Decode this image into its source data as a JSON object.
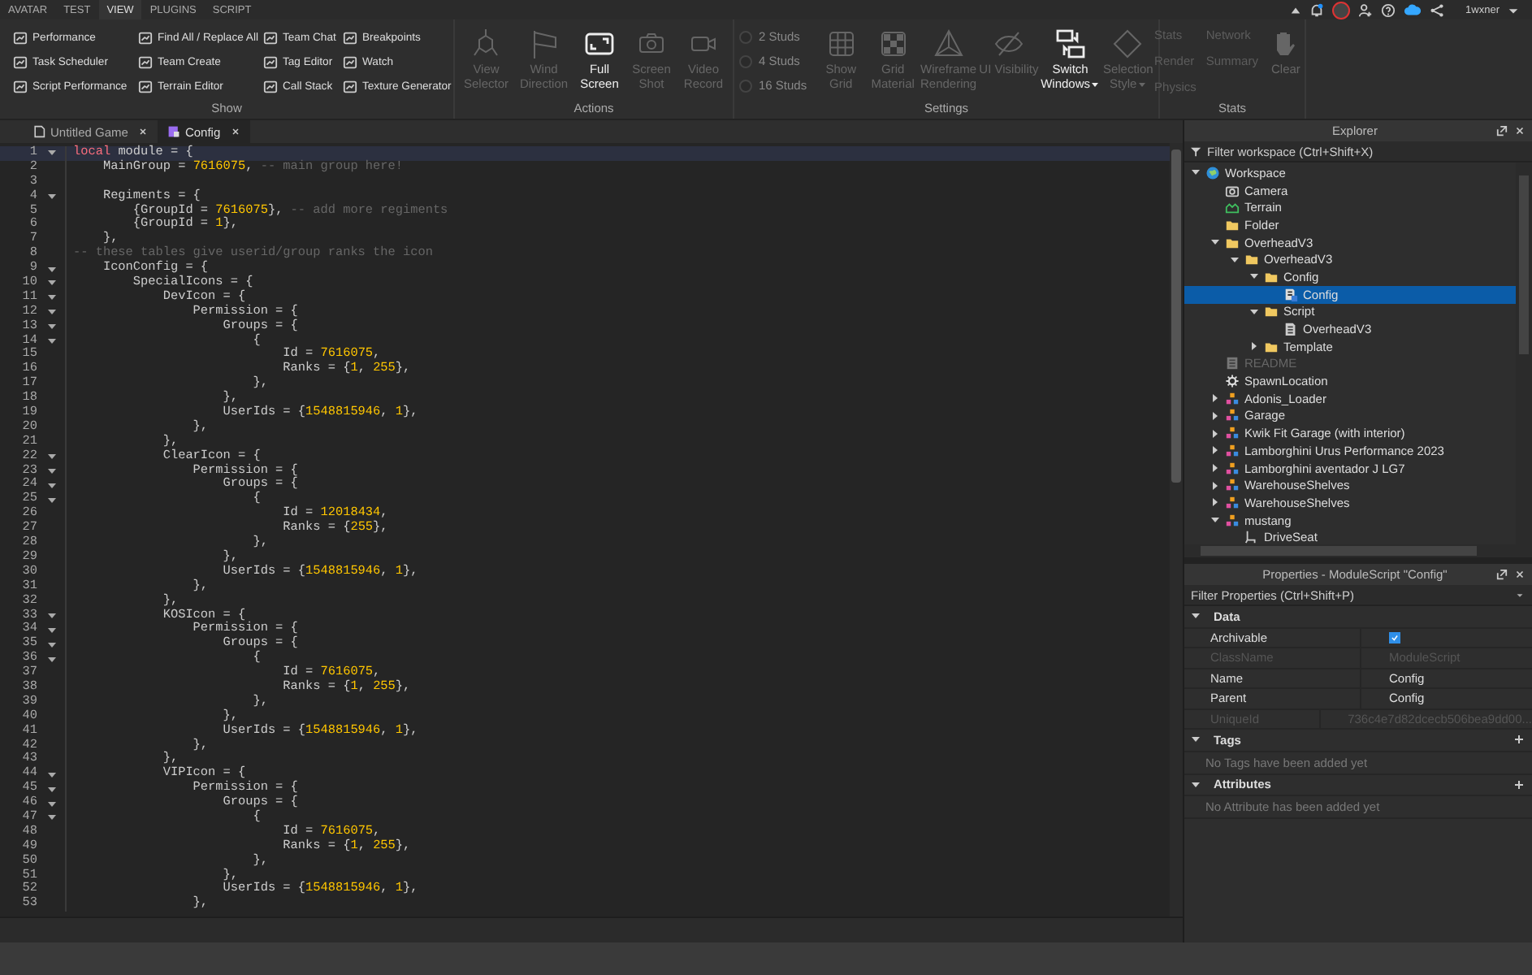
{
  "menu_tabs": [
    {
      "label": "AVATAR",
      "selected": false
    },
    {
      "label": "TEST",
      "selected": false
    },
    {
      "label": "VIEW",
      "selected": true
    },
    {
      "label": "PLUGINS",
      "selected": false
    },
    {
      "label": "SCRIPT",
      "selected": false
    }
  ],
  "user": {
    "name": "1wxner"
  },
  "ribbon": {
    "show": {
      "label": "Show",
      "items": [
        {
          "label": "Performance"
        },
        {
          "label": "Task Scheduler"
        },
        {
          "label": "Script Performance"
        },
        {
          "label": "Find All / Replace All"
        },
        {
          "label": "Team Create"
        },
        {
          "label": "Terrain Editor"
        },
        {
          "label": "Team Chat"
        },
        {
          "label": "Tag Editor"
        },
        {
          "label": "Call Stack"
        },
        {
          "label": "Breakpoints"
        },
        {
          "label": "Watch"
        },
        {
          "label": "Texture Generator"
        }
      ]
    },
    "actions": {
      "label": "Actions",
      "buttons": [
        {
          "label": [
            "View",
            "Selector"
          ],
          "disabled": true,
          "dropdown": false
        },
        {
          "label": [
            "Wind",
            "Direction"
          ],
          "disabled": true,
          "dropdown": false
        },
        {
          "label": [
            "Full",
            "Screen"
          ],
          "disabled": false,
          "dropdown": false
        },
        {
          "label": [
            "Screen",
            "Shot"
          ],
          "disabled": true,
          "dropdown": false
        },
        {
          "label": [
            "Video",
            "Record"
          ],
          "disabled": true,
          "dropdown": false
        }
      ]
    },
    "settings": {
      "label": "Settings",
      "studs": [
        {
          "label": "2 Studs",
          "disabled": true
        },
        {
          "label": "4 Studs",
          "disabled": true
        },
        {
          "label": "16 Studs",
          "disabled": true
        }
      ],
      "buttons": [
        {
          "label": [
            "Show",
            "Grid"
          ],
          "disabled": true,
          "dropdown": false
        },
        {
          "label": [
            "Grid",
            "Material"
          ],
          "disabled": true,
          "dropdown": false
        },
        {
          "label": [
            "Wireframe",
            "Rendering"
          ],
          "disabled": true,
          "dropdown": false
        },
        {
          "label": [
            "UI Visibility"
          ],
          "disabled": true,
          "dropdown": false
        },
        {
          "label": [
            "Switch",
            "Windows"
          ],
          "disabled": false,
          "dropdown": true
        },
        {
          "label": [
            "Selection",
            "Style"
          ],
          "disabled": true,
          "dropdown": true
        }
      ]
    },
    "stats": {
      "label": "Stats",
      "links": [
        {
          "label": "Stats"
        },
        {
          "label": "Network"
        },
        {
          "label": "Render"
        },
        {
          "label": "Summary"
        },
        {
          "label": "Physics"
        }
      ],
      "buttons": [
        {
          "label": [
            "Clear"
          ],
          "disabled": true,
          "dropdown": false
        }
      ]
    }
  },
  "doc_tabs": [
    {
      "label": "Untitled Game",
      "selected": false
    },
    {
      "label": "Config",
      "selected": true
    }
  ],
  "code": [
    {
      "number": "1",
      "fold": true,
      "current": true,
      "segments": [
        {
          "kind": "kw",
          "text": "local"
        },
        {
          "kind": "text",
          "text": " module = {"
        }
      ]
    },
    {
      "number": "2",
      "fold": false,
      "current": false,
      "segments": [
        {
          "kind": "text",
          "text": "    MainGroup = "
        },
        {
          "kind": "num",
          "text": "7616075"
        },
        {
          "kind": "text",
          "text": ", "
        },
        {
          "kind": "com",
          "text": "-- main group here!"
        }
      ]
    },
    {
      "number": "3",
      "fold": false,
      "current": false
    },
    {
      "number": "4",
      "fold": true,
      "current": false,
      "segments": [
        {
          "kind": "text",
          "text": "    Regiments = {"
        }
      ]
    },
    {
      "number": "5",
      "fold": false,
      "current": false,
      "segments": [
        {
          "kind": "text",
          "text": "        {GroupId = "
        },
        {
          "kind": "num",
          "text": "7616075"
        },
        {
          "kind": "text",
          "text": "}, "
        },
        {
          "kind": "com",
          "text": "-- add more regiments"
        }
      ]
    },
    {
      "number": "6",
      "fold": false,
      "current": false,
      "segments": [
        {
          "kind": "text",
          "text": "        {GroupId = "
        },
        {
          "kind": "num",
          "text": "1"
        },
        {
          "kind": "text",
          "text": "},"
        }
      ]
    },
    {
      "number": "7",
      "fold": false,
      "current": false,
      "segments": [
        {
          "kind": "text",
          "text": "    },"
        }
      ]
    },
    {
      "number": "8",
      "fold": false,
      "current": false,
      "segments": [
        {
          "kind": "com",
          "text": "-- these tables give userid/group ranks the icon"
        }
      ]
    },
    {
      "number": "9",
      "fold": true,
      "current": false,
      "segments": [
        {
          "kind": "text",
          "text": "    IconConfig = {"
        }
      ]
    },
    {
      "number": "10",
      "fold": true,
      "current": false,
      "segments": [
        {
          "kind": "text",
          "text": "        SpecialIcons = {"
        }
      ]
    },
    {
      "number": "11",
      "fold": true,
      "current": false,
      "segments": [
        {
          "kind": "text",
          "text": "            DevIcon = {"
        }
      ]
    },
    {
      "number": "12",
      "fold": true,
      "current": false,
      "segments": [
        {
          "kind": "text",
          "text": "                Permission = {"
        }
      ]
    },
    {
      "number": "13",
      "fold": true,
      "current": false,
      "segments": [
        {
          "kind": "text",
          "text": "                    Groups = {"
        }
      ]
    },
    {
      "number": "14",
      "fold": true,
      "current": false,
      "segments": [
        {
          "kind": "text",
          "text": "                        {"
        }
      ]
    },
    {
      "number": "15",
      "fold": false,
      "current": false,
      "segments": [
        {
          "kind": "text",
          "text": "                            Id = "
        },
        {
          "kind": "num",
          "text": "7616075"
        },
        {
          "kind": "text",
          "text": ","
        }
      ]
    },
    {
      "number": "16",
      "fold": false,
      "current": false,
      "segments": [
        {
          "kind": "text",
          "text": "                            Ranks = {"
        },
        {
          "kind": "num",
          "text": "1"
        },
        {
          "kind": "text",
          "text": ", "
        },
        {
          "kind": "num",
          "text": "255"
        },
        {
          "kind": "text",
          "text": "},"
        }
      ]
    },
    {
      "number": "17",
      "fold": false,
      "current": false,
      "segments": [
        {
          "kind": "text",
          "text": "                        },"
        }
      ]
    },
    {
      "number": "18",
      "fold": false,
      "current": false,
      "segments": [
        {
          "kind": "text",
          "text": "                    },"
        }
      ]
    },
    {
      "number": "19",
      "fold": false,
      "current": false,
      "segments": [
        {
          "kind": "text",
          "text": "                    UserIds = {"
        },
        {
          "kind": "num",
          "text": "1548815946"
        },
        {
          "kind": "text",
          "text": ", "
        },
        {
          "kind": "num",
          "text": "1"
        },
        {
          "kind": "text",
          "text": "},"
        }
      ]
    },
    {
      "number": "20",
      "fold": false,
      "current": false,
      "segments": [
        {
          "kind": "text",
          "text": "                },"
        }
      ]
    },
    {
      "number": "21",
      "fold": false,
      "current": false,
      "segments": [
        {
          "kind": "text",
          "text": "            },"
        }
      ]
    },
    {
      "number": "22",
      "fold": true,
      "current": false,
      "segments": [
        {
          "kind": "text",
          "text": "            ClearIcon = {"
        }
      ]
    },
    {
      "number": "23",
      "fold": true,
      "current": false,
      "segments": [
        {
          "kind": "text",
          "text": "                Permission = {"
        }
      ]
    },
    {
      "number": "24",
      "fold": true,
      "current": false,
      "segments": [
        {
          "kind": "text",
          "text": "                    Groups = {"
        }
      ]
    },
    {
      "number": "25",
      "fold": true,
      "current": false,
      "segments": [
        {
          "kind": "text",
          "text": "                        {"
        }
      ]
    },
    {
      "number": "26",
      "fold": false,
      "current": false,
      "segments": [
        {
          "kind": "text",
          "text": "                            Id = "
        },
        {
          "kind": "num",
          "text": "12018434"
        },
        {
          "kind": "text",
          "text": ","
        }
      ]
    },
    {
      "number": "27",
      "fold": false,
      "current": false,
      "segments": [
        {
          "kind": "text",
          "text": "                            Ranks = {"
        },
        {
          "kind": "num",
          "text": "255"
        },
        {
          "kind": "text",
          "text": "},"
        }
      ]
    },
    {
      "number": "28",
      "fold": false,
      "current": false,
      "segments": [
        {
          "kind": "text",
          "text": "                        },"
        }
      ]
    },
    {
      "number": "29",
      "fold": false,
      "current": false,
      "segments": [
        {
          "kind": "text",
          "text": "                    },"
        }
      ]
    },
    {
      "number": "30",
      "fold": false,
      "current": false,
      "segments": [
        {
          "kind": "text",
          "text": "                    UserIds = {"
        },
        {
          "kind": "num",
          "text": "1548815946"
        },
        {
          "kind": "text",
          "text": ", "
        },
        {
          "kind": "num",
          "text": "1"
        },
        {
          "kind": "text",
          "text": "},"
        }
      ]
    },
    {
      "number": "31",
      "fold": false,
      "current": false,
      "segments": [
        {
          "kind": "text",
          "text": "                },"
        }
      ]
    },
    {
      "number": "32",
      "fold": false,
      "current": false,
      "segments": [
        {
          "kind": "text",
          "text": "            },"
        }
      ]
    },
    {
      "number": "33",
      "fold": true,
      "current": false,
      "segments": [
        {
          "kind": "text",
          "text": "            KOSIcon = {"
        }
      ]
    },
    {
      "number": "34",
      "fold": true,
      "current": false,
      "segments": [
        {
          "kind": "text",
          "text": "                Permission = {"
        }
      ]
    },
    {
      "number": "35",
      "fold": true,
      "current": false,
      "segments": [
        {
          "kind": "text",
          "text": "                    Groups = {"
        }
      ]
    },
    {
      "number": "36",
      "fold": true,
      "current": false,
      "segments": [
        {
          "kind": "text",
          "text": "                        {"
        }
      ]
    },
    {
      "number": "37",
      "fold": false,
      "current": false,
      "segments": [
        {
          "kind": "text",
          "text": "                            Id = "
        },
        {
          "kind": "num",
          "text": "7616075"
        },
        {
          "kind": "text",
          "text": ","
        }
      ]
    },
    {
      "number": "38",
      "fold": false,
      "current": false,
      "segments": [
        {
          "kind": "text",
          "text": "                            Ranks = {"
        },
        {
          "kind": "num",
          "text": "1"
        },
        {
          "kind": "text",
          "text": ", "
        },
        {
          "kind": "num",
          "text": "255"
        },
        {
          "kind": "text",
          "text": "},"
        }
      ]
    },
    {
      "number": "39",
      "fold": false,
      "current": false,
      "segments": [
        {
          "kind": "text",
          "text": "                        },"
        }
      ]
    },
    {
      "number": "40",
      "fold": false,
      "current": false,
      "segments": [
        {
          "kind": "text",
          "text": "                    },"
        }
      ]
    },
    {
      "number": "41",
      "fold": false,
      "current": false,
      "segments": [
        {
          "kind": "text",
          "text": "                    UserIds = {"
        },
        {
          "kind": "num",
          "text": "1548815946"
        },
        {
          "kind": "text",
          "text": ", "
        },
        {
          "kind": "num",
          "text": "1"
        },
        {
          "kind": "text",
          "text": "},"
        }
      ]
    },
    {
      "number": "42",
      "fold": false,
      "current": false,
      "segments": [
        {
          "kind": "text",
          "text": "                },"
        }
      ]
    },
    {
      "number": "43",
      "fold": false,
      "current": false,
      "segments": [
        {
          "kind": "text",
          "text": "            },"
        }
      ]
    },
    {
      "number": "44",
      "fold": true,
      "current": false,
      "segments": [
        {
          "kind": "text",
          "text": "            VIPIcon = {"
        }
      ]
    },
    {
      "number": "45",
      "fold": true,
      "current": false,
      "segments": [
        {
          "kind": "text",
          "text": "                Permission = {"
        }
      ]
    },
    {
      "number": "46",
      "fold": true,
      "current": false,
      "segments": [
        {
          "kind": "text",
          "text": "                    Groups = {"
        }
      ]
    },
    {
      "number": "47",
      "fold": true,
      "current": false,
      "segments": [
        {
          "kind": "text",
          "text": "                        {"
        }
      ]
    },
    {
      "number": "48",
      "fold": false,
      "current": false,
      "segments": [
        {
          "kind": "text",
          "text": "                            Id = "
        },
        {
          "kind": "num",
          "text": "7616075"
        },
        {
          "kind": "text",
          "text": ","
        }
      ]
    },
    {
      "number": "49",
      "fold": false,
      "current": false,
      "segments": [
        {
          "kind": "text",
          "text": "                            Ranks = {"
        },
        {
          "kind": "num",
          "text": "1"
        },
        {
          "kind": "text",
          "text": ", "
        },
        {
          "kind": "num",
          "text": "255"
        },
        {
          "kind": "text",
          "text": "},"
        }
      ]
    },
    {
      "number": "50",
      "fold": false,
      "current": false,
      "segments": [
        {
          "kind": "text",
          "text": "                        },"
        }
      ]
    },
    {
      "number": "51",
      "fold": false,
      "current": false,
      "segments": [
        {
          "kind": "text",
          "text": "                    },"
        }
      ]
    },
    {
      "number": "52",
      "fold": false,
      "current": false,
      "segments": [
        {
          "kind": "text",
          "text": "                    UserIds = {"
        },
        {
          "kind": "num",
          "text": "1548815946"
        },
        {
          "kind": "text",
          "text": ", "
        },
        {
          "kind": "num",
          "text": "1"
        },
        {
          "kind": "text",
          "text": "},"
        }
      ]
    },
    {
      "number": "53",
      "fold": false,
      "current": false,
      "segments": [
        {
          "kind": "text",
          "text": "                },"
        }
      ]
    }
  ],
  "explorer": {
    "title": "Explorer",
    "filter": {
      "placeholder": "Filter workspace (Ctrl+Shift+X)"
    },
    "tree": [
      {
        "label": "Workspace",
        "kind": "workspace",
        "expandable": true,
        "expanded": true,
        "selected": false,
        "dimmed": false,
        "children": [
          {
            "label": "Camera",
            "kind": "camera",
            "expandable": false,
            "expanded": false,
            "selected": false,
            "dimmed": false
          },
          {
            "label": "Terrain",
            "kind": "terrain",
            "expandable": false,
            "expanded": false,
            "selected": false,
            "dimmed": false
          },
          {
            "label": "Folder",
            "kind": "folder",
            "expandable": false,
            "expanded": false,
            "selected": false,
            "dimmed": false
          },
          {
            "label": "OverheadV3",
            "kind": "folder",
            "expandable": true,
            "expanded": true,
            "selected": false,
            "dimmed": false,
            "children": [
              {
                "label": "OverheadV3",
                "kind": "folder",
                "expandable": true,
                "expanded": true,
                "selected": false,
                "dimmed": false,
                "children": [
                  {
                    "label": "Config",
                    "kind": "folder",
                    "expandable": true,
                    "expanded": true,
                    "selected": false,
                    "dimmed": false,
                    "children": [
                      {
                        "label": "Config",
                        "kind": "module",
                        "expandable": false,
                        "expanded": false,
                        "selected": true,
                        "dimmed": false
                      }
                    ]
                  },
                  {
                    "label": "Script",
                    "kind": "folder",
                    "expandable": true,
                    "expanded": true,
                    "selected": false,
                    "dimmed": false,
                    "children": [
                      {
                        "label": "OverheadV3",
                        "kind": "script",
                        "expandable": false,
                        "expanded": false,
                        "selected": false,
                        "dimmed": false
                      }
                    ]
                  },
                  {
                    "label": "Template",
                    "kind": "folder",
                    "expandable": true,
                    "expanded": false,
                    "selected": false,
                    "dimmed": false
                  }
                ]
              }
            ]
          },
          {
            "label": "README",
            "kind": "document",
            "expandable": false,
            "expanded": false,
            "selected": false,
            "dimmed": true
          },
          {
            "label": "SpawnLocation",
            "kind": "spawn",
            "expandable": false,
            "expanded": false,
            "selected": false,
            "dimmed": false
          },
          {
            "label": "Adonis_Loader",
            "kind": "model",
            "expandable": true,
            "expanded": false,
            "selected": false,
            "dimmed": false
          },
          {
            "label": "Garage",
            "kind": "model",
            "expandable": true,
            "expanded": false,
            "selected": false,
            "dimmed": false
          },
          {
            "label": "Kwik Fit Garage (with interior)",
            "kind": "model",
            "expandable": true,
            "expanded": false,
            "selected": false,
            "dimmed": false
          },
          {
            "label": "Lamborghini Urus Performance 2023",
            "kind": "model",
            "expandable": true,
            "expanded": false,
            "selected": false,
            "dimmed": false
          },
          {
            "label": "Lamborghini aventador J LG7",
            "kind": "model",
            "expandable": true,
            "expanded": false,
            "selected": false,
            "dimmed": false
          },
          {
            "label": "WarehouseShelves",
            "kind": "model",
            "expandable": true,
            "expanded": false,
            "selected": false,
            "dimmed": false
          },
          {
            "label": "WarehouseShelves",
            "kind": "model",
            "expandable": true,
            "expanded": false,
            "selected": false,
            "dimmed": false
          },
          {
            "label": "mustang",
            "kind": "model",
            "expandable": true,
            "expanded": true,
            "selected": false,
            "dimmed": false,
            "children": [
              {
                "label": "DriveSeat",
                "kind": "seat",
                "expandable": false,
                "expanded": false,
                "selected": false,
                "dimmed": false
              }
            ]
          }
        ]
      }
    ]
  },
  "properties": {
    "title": "Properties - ModuleScript \"Config\"",
    "filter": {
      "placeholder": "Filter Properties (Ctrl+Shift+P)"
    },
    "sections": [
      {
        "label": "Data",
        "expanded": true,
        "addable": false,
        "rows": [
          {
            "name": "Archivable",
            "kind": "checkbox",
            "checked": true,
            "dimmed": false
          },
          {
            "name": "ClassName",
            "kind": "text",
            "value": "ModuleScript",
            "dimmed": true
          },
          {
            "name": "Name",
            "kind": "text",
            "value": "Config",
            "dimmed": false
          },
          {
            "name": "Parent",
            "kind": "text",
            "value": "Config",
            "dimmed": false
          },
          {
            "name": "UniqueId",
            "kind": "text",
            "value": "736c4e7d82dcecb506bea9dd00...",
            "dimmed": true
          }
        ]
      },
      {
        "label": "Tags",
        "expanded": true,
        "addable": true,
        "message": "No Tags have been added yet"
      },
      {
        "label": "Attributes",
        "expanded": true,
        "addable": true,
        "message": "No Attribute has been added yet"
      }
    ]
  }
}
